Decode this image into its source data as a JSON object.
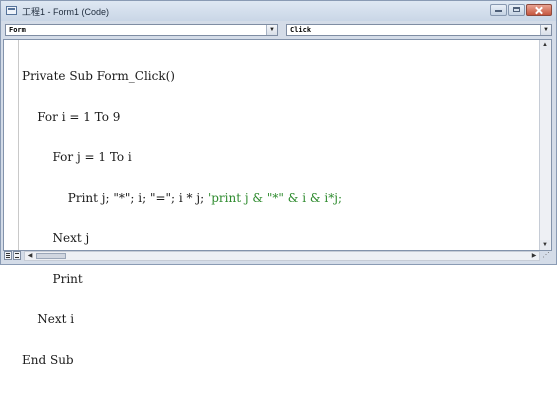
{
  "window": {
    "title": "工程1 - Form1 (Code)"
  },
  "object_combo": {
    "value": "Form"
  },
  "procedure_combo": {
    "value": "Click"
  },
  "code_lines": [
    "Private Sub Form_Click()",
    "    For i = 1 To 9",
    "        For j = 1 To i",
    "            Print j; \"*\"; i; \"=\"; i * j; ",
    "        Next j",
    "        Print",
    "    Next i",
    "End Sub"
  ],
  "code_comment": "'print j & \"*\" & i & i*j;",
  "icons": {
    "title": "code-window-icon",
    "minimize": "minimize-icon",
    "maximize": "maximize-icon",
    "close": "close-icon",
    "dropdown": "chevron-down-icon"
  },
  "colors": {
    "comment": "#2e8b2e",
    "close_button": "#c5563f",
    "titlebar": "#c9d6e6"
  }
}
